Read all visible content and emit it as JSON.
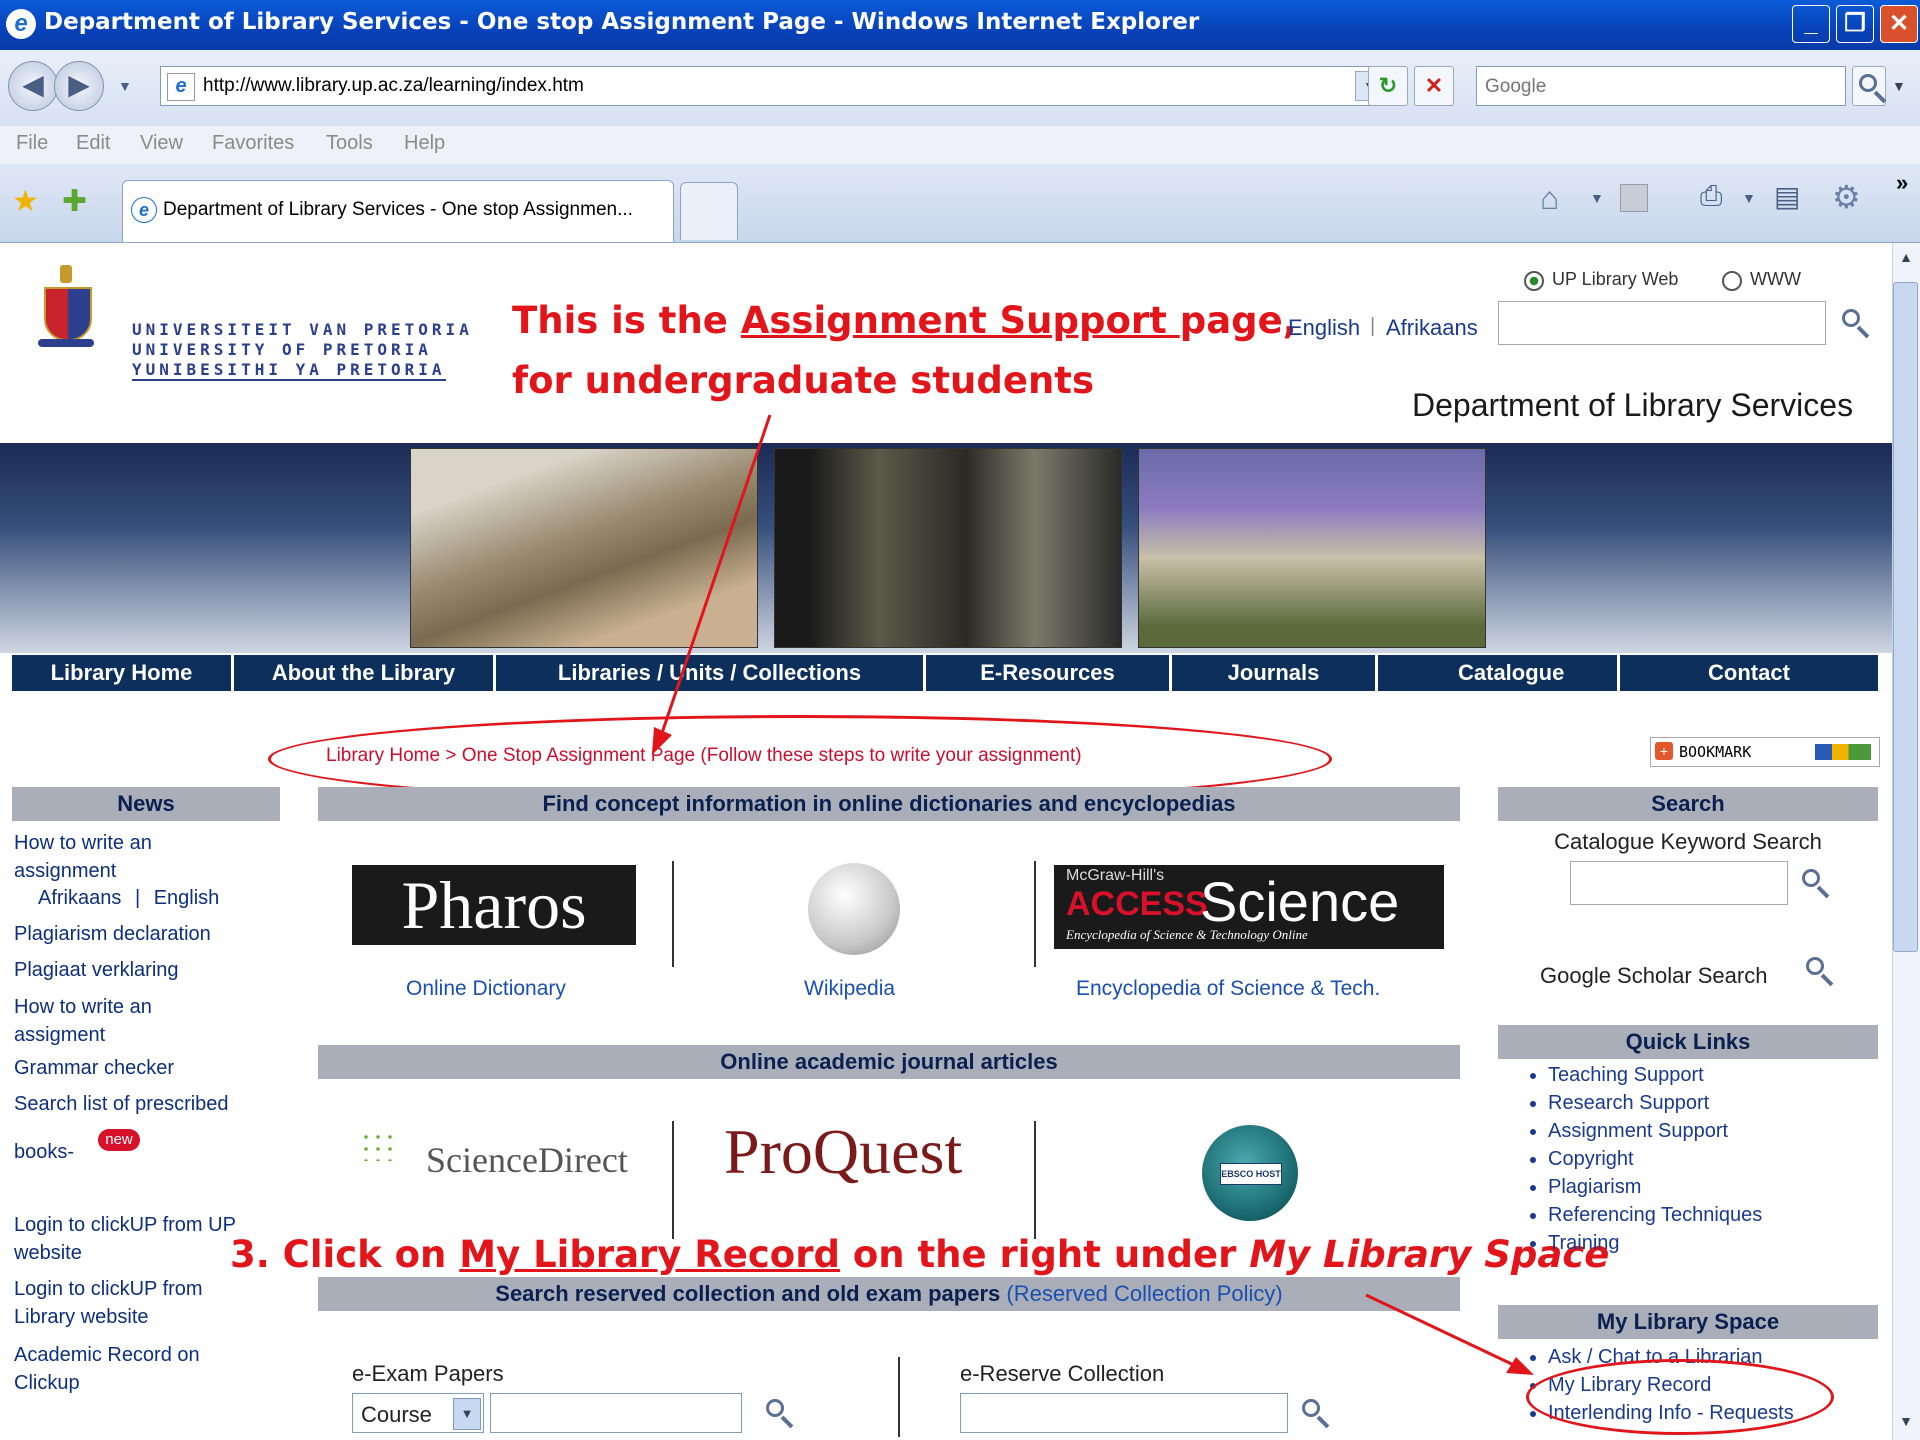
{
  "window": {
    "title": "Department of Library Services - One stop Assignment Page - Windows Internet Explorer"
  },
  "address_bar": {
    "url": "http://www.library.up.ac.za/learning/index.htm",
    "search_placeholder": "Google"
  },
  "menu": [
    "File",
    "Edit",
    "View",
    "Favorites",
    "Tools",
    "Help"
  ],
  "tab": {
    "label": "Department of Library Services - One stop Assignmen..."
  },
  "header": {
    "logo_lines": [
      "UNIVERSITEIT VAN PRETORIA",
      "UNIVERSITY OF PRETORIA",
      "YUNIBESITHI YA PRETORIA"
    ],
    "radio_web": "UP Library Web",
    "radio_www": "WWW",
    "lang_english": "English",
    "lang_sep": "|",
    "lang_afrikaans": "Afrikaans",
    "dept": "Department of Library Services"
  },
  "annotations": {
    "top_line1_pre": "This is the ",
    "top_line1_link": "Assignment Support ",
    "top_line1_post": "page,",
    "top_line2": "for undergraduate students",
    "step_pre": "3. Click on ",
    "step_link": "My Library Record",
    "step_mid": " on the right under ",
    "step_em": "My Library Space",
    "annotation_color": "#e1151a"
  },
  "nav": [
    "Library Home",
    "About the Library",
    "Libraries / Units / Collections",
    "E-Resources",
    "Journals",
    "Catalogue",
    "Contact"
  ],
  "breadcrumb": "Library Home > One Stop Assignment Page (Follow these steps to write your assignment)",
  "bookmark_label": "BOOKMARK",
  "news": {
    "header": "News",
    "item1": "How to write an assignment",
    "item1_af": "Afrikaans",
    "item1_sep": "|",
    "item1_en": "English",
    "items": [
      "Plagiarism declaration",
      "Plagiaat verklaring",
      "How to write an assigment",
      "Grammar checker",
      "Search list of prescribed"
    ],
    "books": "books-",
    "new_badge": "new",
    "login_items": [
      "Login to clickUP from UP website",
      "Login to clickUP from Library website",
      "Academic Record on Clickup"
    ]
  },
  "center": {
    "concept_header": "Find concept information in online dictionaries and encyclopedias",
    "pharos_logo": "Pharos",
    "wikipedia_label": "Wikipedia",
    "dictionary_label": "Online Dictionary",
    "science_brand_small": "McGraw-Hill's",
    "science_brand_access": "ACCESS",
    "science_brand_word": "Science",
    "science_tagline": "Encyclopedia of Science & Technology Online",
    "encyclopedia_label": "Encyclopedia of Science & Tech.",
    "journal_header": "Online academic journal articles",
    "sciencedirect_logo": "ScienceDirect",
    "proquest_logo": "ProQuest",
    "ebsco_logo": "EBSCO HOST",
    "reserved_header": "Search reserved collection and old exam papers",
    "reserved_policy": "(Reserved Collection Policy)",
    "exam_label": "e-Exam Papers",
    "exam_select": "Course",
    "reserve_label": "e-Reserve Collection"
  },
  "sidebar": {
    "search_header": "Search",
    "catalogue_label": "Catalogue Keyword Search",
    "scholar_label": "Google Scholar Search",
    "quick_header": "Quick Links",
    "quick_links": [
      "Teaching Support",
      "Research Support",
      "Assignment Support",
      "Copyright",
      "Plagiarism",
      "Referencing Techniques",
      "Training"
    ],
    "space_header": "My Library Space",
    "space_links": [
      "Ask / Chat to a Librarian",
      "My Library Record",
      "Interlending Info - Requests"
    ]
  }
}
